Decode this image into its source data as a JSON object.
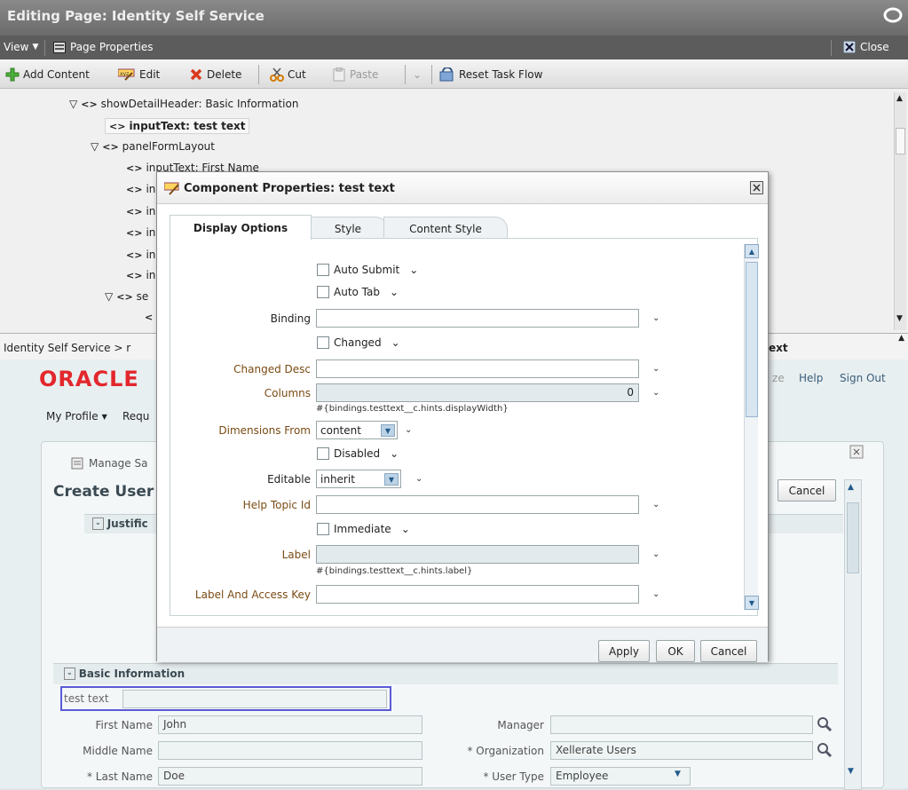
{
  "window": {
    "title": "Editing Page: Identity Self Service",
    "close_label": "Close"
  },
  "menubar": {
    "view_label": "View",
    "page_properties_label": "Page Properties"
  },
  "toolbar": {
    "add_content": "Add Content",
    "edit": "Edit",
    "delete": "Delete",
    "cut": "Cut",
    "paste": "Paste",
    "reset_task_flow": "Reset Task Flow"
  },
  "tree": {
    "nodes": [
      {
        "label": "showDetailHeader: Basic Information"
      },
      {
        "label": "inputText: test text"
      },
      {
        "label": "panelFormLayout"
      },
      {
        "label": "inputText: First Name"
      },
      {
        "label": "in"
      },
      {
        "label": "in"
      },
      {
        "label": "in"
      },
      {
        "label": "in"
      },
      {
        "label": "in"
      },
      {
        "label": "se"
      }
    ]
  },
  "app": {
    "breadcrumb": "Identity Self Service > r",
    "breadcrumb_tail": "ext",
    "logo": "ORACLE",
    "header_links": {
      "help": "Help",
      "sign_out": "Sign Out",
      "partial": "ze"
    },
    "nav": {
      "my_profile": "My Profile",
      "requests": "Requ"
    },
    "manage_tab": "Manage Sa",
    "page_title": "Create User",
    "cancel_label": "Cancel",
    "justification_label": "Justific",
    "basic_info_label": "Basic Information",
    "test_text_label": "test text",
    "form": {
      "first_name_label": "First Name",
      "first_name_value": "John",
      "middle_name_label": "Middle Name",
      "middle_name_value": "",
      "last_name_label": "* Last Name",
      "last_name_value": "Doe",
      "manager_label": "Manager",
      "manager_value": "",
      "organization_label": "* Organization",
      "organization_value": "Xellerate Users",
      "user_type_label": "* User Type",
      "user_type_value": "Employee"
    }
  },
  "dialog": {
    "title": "Component Properties: test text",
    "tabs": [
      {
        "label": "Display Options",
        "active": true
      },
      {
        "label": "Style",
        "active": false
      },
      {
        "label": "Content Style",
        "active": false
      }
    ],
    "properties": {
      "auto_submit": "Auto Submit",
      "auto_tab": "Auto Tab",
      "binding_label": "Binding",
      "binding_value": "",
      "changed": "Changed",
      "changed_desc_label": "Changed Desc",
      "changed_desc_value": "",
      "columns_label": "Columns",
      "columns_value": "0",
      "columns_hint": "#{bindings.testtext__c.hints.displayWidth}",
      "dimensions_from_label": "Dimensions From",
      "dimensions_from_value": "content",
      "disabled": "Disabled",
      "editable_label": "Editable",
      "editable_value": "inherit",
      "help_topic_id_label": "Help Topic Id",
      "help_topic_id_value": "",
      "immediate": "Immediate",
      "label_label": "Label",
      "label_value": "",
      "label_hint": "#{bindings.testtext__c.hints.label}",
      "label_access_key_label": "Label And Access Key",
      "label_access_key_value": ""
    },
    "buttons": {
      "apply": "Apply",
      "ok": "OK",
      "cancel": "Cancel"
    }
  },
  "colors": {
    "title_bar": "#7a7a7a",
    "menu_bar": "#5c5c5c",
    "oracle_red": "#e3272c",
    "label_brown": "#7a4b14"
  }
}
